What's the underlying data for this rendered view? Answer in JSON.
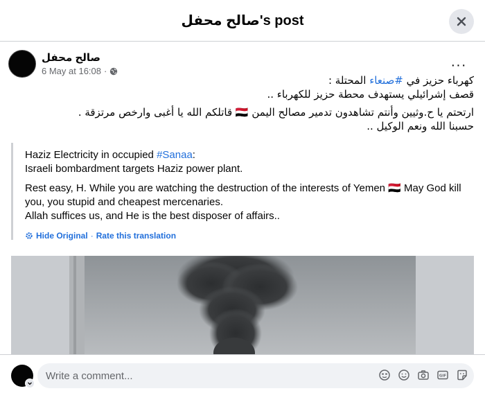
{
  "modal": {
    "title": "صالح محفل's post"
  },
  "post": {
    "author": "صالح محفل",
    "timestamp": "6 May at 16:08",
    "audience_icon": "globe-icon",
    "more_label": "···",
    "arabic": {
      "line1_prefix": "كهرباء حزيز في ",
      "line1_hashtag": "#صنعاء",
      "line1_suffix": " المحتلة  :",
      "line2": "قصف إشرائيلي يستهدف محطة حزيز للكهرباء  ..",
      "line3": "ارتحتم يا ح.وثيين وأنتم تشاهدون تدمير مصالح اليمن 🇾🇪 قاتلكم الله يا أغبى وارخص مرتزقة   .",
      "line4": "حسبنا الله ونعم الوكيل  .."
    },
    "translation": {
      "line1_prefix": "Haziz Electricity in occupied ",
      "line1_hashtag": "#Sanaa",
      "line1_suffix": ":",
      "line2": "Israeli bombardment targets Haziz power plant.",
      "para2": "Rest easy, H. While you are watching the destruction of the interests of Yemen 🇾🇪 May God kill you, you stupid and cheapest mercenaries.",
      "para3": "Allah suffices us, and He is the best disposer of affairs..",
      "hide_original": "Hide Original",
      "separator": "·",
      "rate_translation": "Rate this translation"
    }
  },
  "comment": {
    "placeholder": "Write a comment..."
  },
  "icons": {
    "close": "close-icon",
    "avatar_chevron": "chevron-down-icon",
    "tools": [
      "avatar-sticker-icon",
      "emoji-icon",
      "camera-icon",
      "gif-icon",
      "sticker-icon"
    ]
  },
  "colors": {
    "link": "#216fdb",
    "muted": "#65676b",
    "input_bg": "#f0f2f5",
    "divider": "#ced0d4"
  }
}
